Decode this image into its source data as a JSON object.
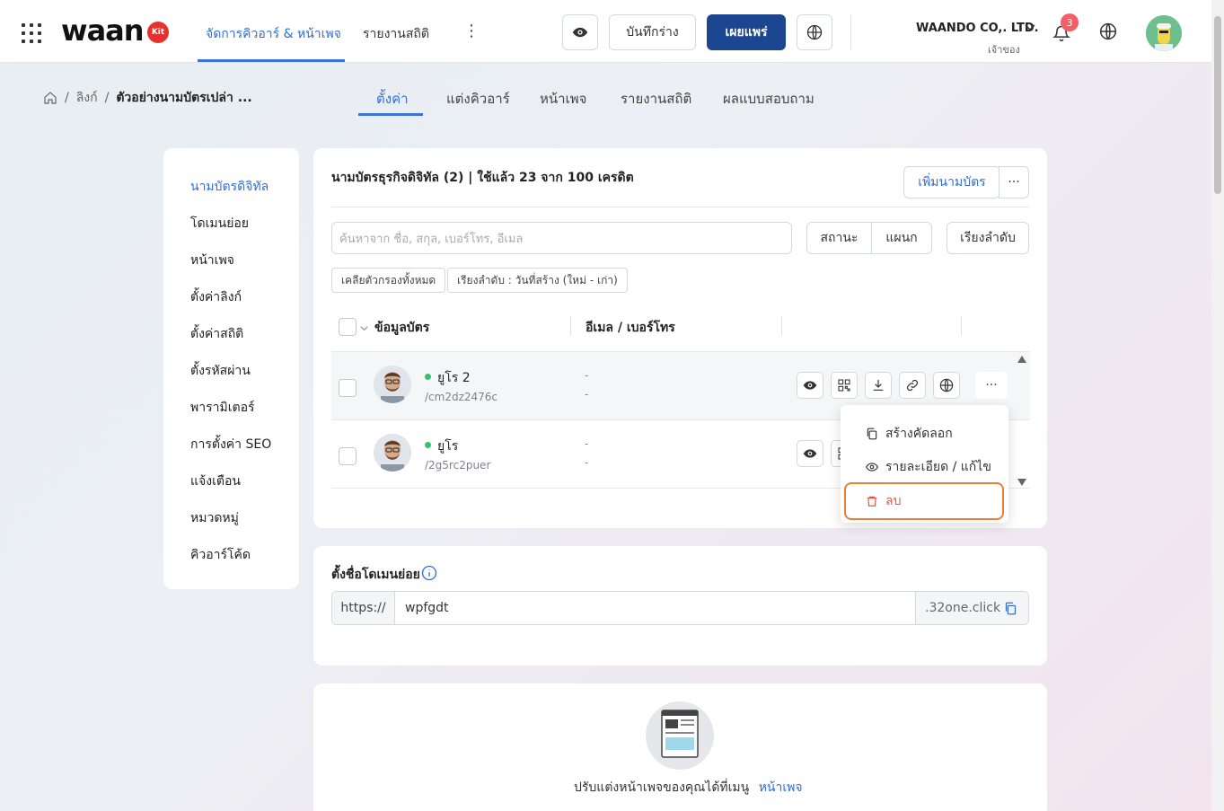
{
  "header": {
    "logo_text": "waan",
    "logo_badge": "Kit",
    "nav": [
      {
        "label": "จัดการคิวอาร์ & หน้าเพจ",
        "active": true
      },
      {
        "label": "รายงานสถิติ",
        "active": false
      }
    ],
    "save_draft_label": "บันทึกร่าง",
    "publish_label": "เผยแพร่",
    "company_name": "WAANDO CO,. LTD.",
    "company_role": "เจ้าของ",
    "notification_count": "3",
    "accent_color": "#2f6ed9",
    "publish_color": "#1d4690"
  },
  "breadcrumb": {
    "items": [
      "ลิงก์",
      "ตัวอย่างนามบัตรเปล่า ..."
    ]
  },
  "subtabs": [
    {
      "label": "ตั้งค่า",
      "active": true
    },
    {
      "label": "แต่งคิวอาร์",
      "active": false
    },
    {
      "label": "หน้าเพจ",
      "active": false
    },
    {
      "label": "รายงานสถิติ",
      "active": false
    },
    {
      "label": "ผลแบบสอบถาม",
      "active": false
    }
  ],
  "sidebar": {
    "items": [
      {
        "label": "นามบัตรดิจิทัล",
        "active": true
      },
      {
        "label": "โดเมนย่อย"
      },
      {
        "label": "หน้าเพจ"
      },
      {
        "label": "ตั้งค่าลิงก์"
      },
      {
        "label": "ตั้งค่าสถิติ"
      },
      {
        "label": "ตั้งรหัสผ่าน"
      },
      {
        "label": "พารามิเตอร์"
      },
      {
        "label": "การตั้งค่า SEO"
      },
      {
        "label": "แจ้งเตือน"
      },
      {
        "label": "หมวดหมู่"
      },
      {
        "label": "คิวอาร์โค้ด"
      }
    ]
  },
  "cards": {
    "title": "นามบัตรธุรกิจดิจิทัล (2) | ใช้แล้ว 23 จาก 100 เครดิต",
    "add_button": "เพิ่มนามบัตร",
    "more_label": "···",
    "search_placeholder": "ค้นหาจาก ชื่อ, สกุล, เบอร์โทร, อีเมล",
    "filter_status": "สถานะ",
    "filter_department": "แผนก",
    "sort_button": "เรียงลำดับ",
    "chip_clear": "เคลียตัวกรองทั้งหมด",
    "chip_sort": "เรียงลำดับ : วันที่สร้าง (ใหม่ - เก่า)",
    "columns": [
      "ข้อมูลบัตร",
      "อีเมล / เบอร์โทร"
    ],
    "rows": [
      {
        "name": "ยูโร 2",
        "slug": "/cm2dz2476c",
        "email": "-",
        "phone": "-",
        "status": "active"
      },
      {
        "name": "ยูโร",
        "slug": "/2g5rc2puer",
        "email": "-",
        "phone": "-",
        "status": "active"
      }
    ],
    "row_menu": {
      "duplicate": "สร้างคัดลอก",
      "details": "รายละเอียด / แก้ไข",
      "delete": "ลบ",
      "delete_color": "#e8553f",
      "highlight_color": "#f07c3a"
    }
  },
  "subdomain": {
    "title": "ตั้งชื่อโดเมนย่อย",
    "prefix": "https://",
    "value": "wpfgdt",
    "suffix": ".32one.click"
  },
  "page_hint": {
    "text": "ปรับแต่งหน้าเพจของคุณได้ที่เมนู",
    "link": "หน้าเพจ"
  }
}
